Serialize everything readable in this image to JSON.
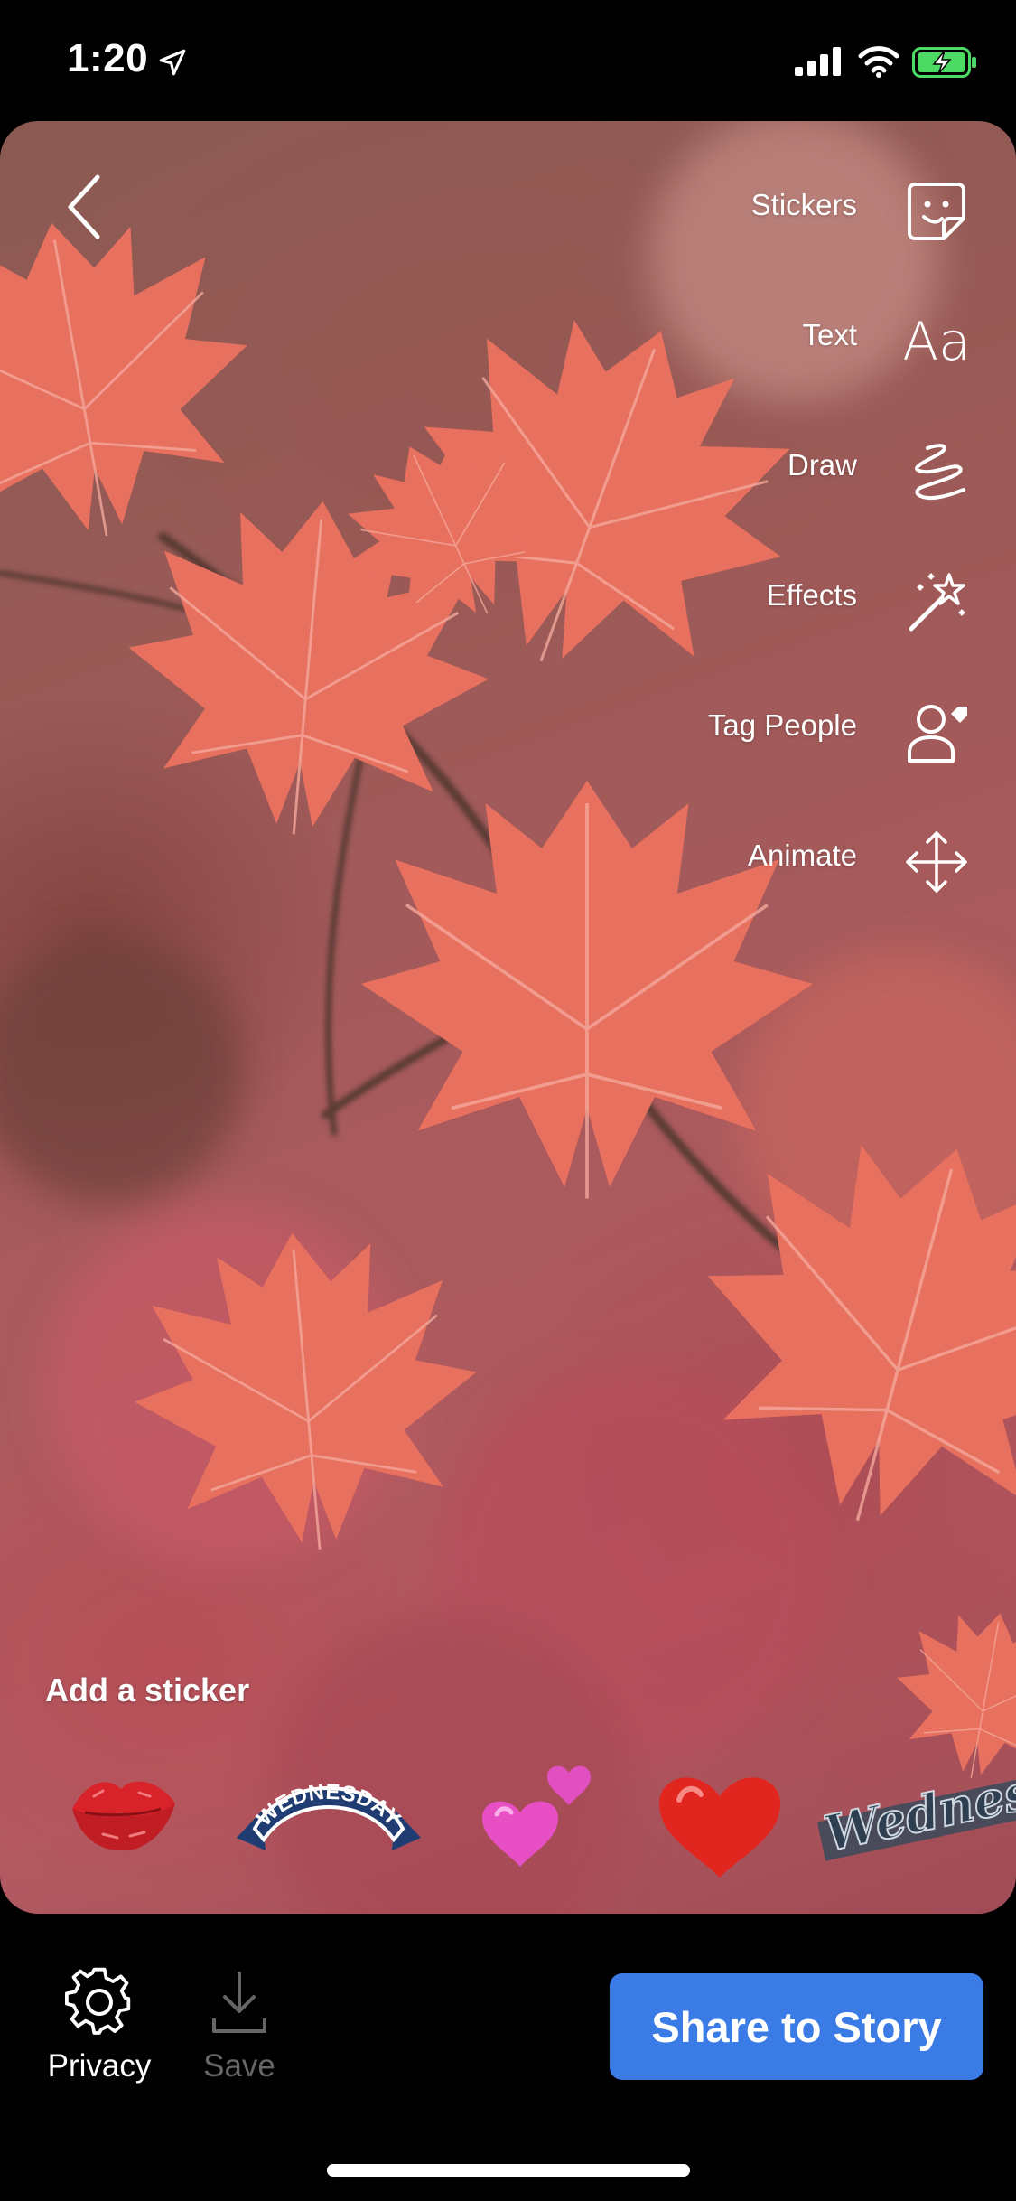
{
  "status": {
    "time": "1:20",
    "icons": [
      "location-arrow-icon",
      "cellular-signal-icon",
      "wifi-icon",
      "battery-charging-icon"
    ],
    "battery_color": "#4cd964"
  },
  "editor": {
    "back_icon": "chevron-left-icon",
    "tools": [
      {
        "label": "Stickers",
        "icon": "sticker-icon"
      },
      {
        "label": "Text",
        "icon": "text-aa-icon"
      },
      {
        "label": "Draw",
        "icon": "scribble-icon"
      },
      {
        "label": "Effects",
        "icon": "magic-wand-icon"
      },
      {
        "label": "Tag People",
        "icon": "tag-person-icon"
      },
      {
        "label": "Animate",
        "icon": "move-arrows-icon"
      }
    ],
    "tool_text_aa": "Aa"
  },
  "sticker_tray": {
    "heading": "Add a sticker",
    "stickers": [
      {
        "name": "lips-sticker"
      },
      {
        "name": "wednesday-banner-sticker",
        "text": "WEDNESDAY"
      },
      {
        "name": "two-hearts-sticker"
      },
      {
        "name": "red-heart-sticker"
      },
      {
        "name": "wednesday-script-sticker",
        "text": "Wednesday"
      }
    ]
  },
  "bottom_bar": {
    "privacy_label": "Privacy",
    "save_label": "Save",
    "share_label": "Share to Story"
  },
  "colors": {
    "share_button": "#3b7be6",
    "leaf": "#e8705f",
    "save_disabled": "#666666"
  }
}
